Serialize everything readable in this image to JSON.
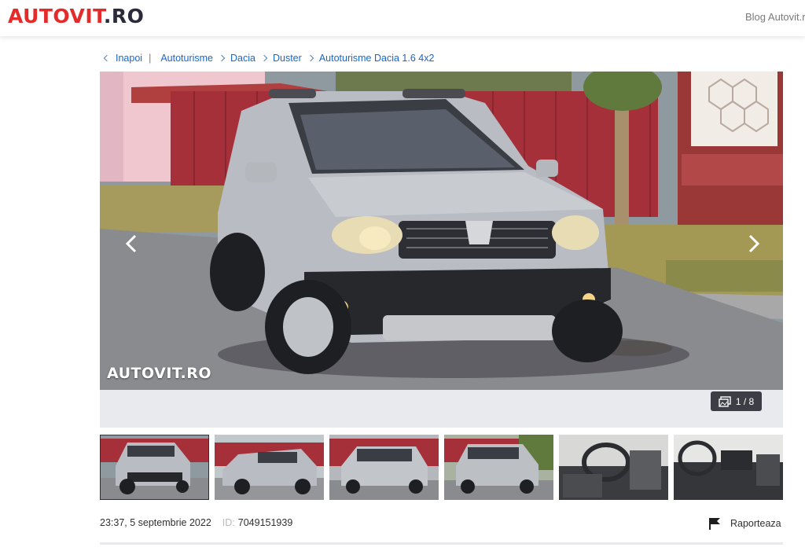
{
  "header": {
    "logo_part1": "AUTOVIT",
    "logo_part2": ".RO",
    "blog_link": "Blog Autovit.ro"
  },
  "breadcrumb": {
    "back": "Inapoi",
    "separator": "|",
    "items": [
      "Autoturisme",
      "Dacia",
      "Duster",
      "Autoturisme Dacia 1.6 4x2"
    ]
  },
  "gallery": {
    "watermark": "AUTOVIT.RO",
    "counter": "1 / 8",
    "icons": {
      "prev": "chevron-left-icon",
      "next": "chevron-right-icon",
      "photos": "photos-icon"
    },
    "thumbnail_count": 6,
    "active_thumbnail": 1
  },
  "listing": {
    "posted": "23:37, 5 septembrie 2022",
    "id_label": "ID:",
    "id_value": "7049151939",
    "report_label": "Raporteaza",
    "report_icon": "flag-icon"
  },
  "colors": {
    "brand_red": "#e52a2a",
    "link_blue": "#1a66c8",
    "gallery_bg": "#e9eaee"
  }
}
